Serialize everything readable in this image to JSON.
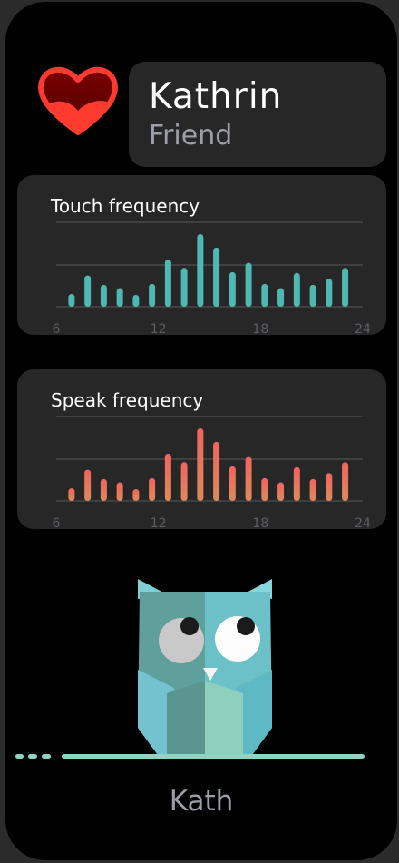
{
  "profile": {
    "name": "Kathrin",
    "relation": "Friend",
    "nickname": "Kath"
  },
  "colors": {
    "heart_fill": "#6e0000",
    "heart_stroke": "#ff3b30",
    "touch_bars": "#4fb7b4",
    "speak_bars_top": "#f0645e",
    "speak_bars_bottom": "#dd8a5a",
    "owl_body": "#5aa6a4",
    "baseline": "#8fd3c3"
  },
  "chart_data": [
    {
      "type": "bar",
      "title": "Touch frequency",
      "x": [
        7,
        8,
        9,
        10,
        11,
        12,
        13,
        14,
        15,
        16,
        17,
        18,
        19,
        20,
        21,
        22,
        23
      ],
      "values": [
        15,
        37,
        26,
        22,
        14,
        27,
        56,
        46,
        86,
        70,
        41,
        52,
        27,
        22,
        40,
        26,
        33,
        46
      ],
      "xlim": [
        6,
        24
      ],
      "xticks": [
        "6",
        "12",
        "18",
        "24"
      ],
      "ylim": [
        0,
        100
      ],
      "grid": true
    },
    {
      "type": "bar",
      "title": "Speak frequency",
      "x": [
        7,
        8,
        9,
        10,
        11,
        12,
        13,
        14,
        15,
        16,
        17,
        18,
        19,
        20,
        21,
        22,
        23
      ],
      "values": [
        15,
        37,
        26,
        22,
        14,
        27,
        56,
        46,
        86,
        70,
        41,
        52,
        27,
        22,
        40,
        26,
        33,
        46
      ],
      "xlim": [
        6,
        24
      ],
      "xticks": [
        "6",
        "12",
        "18",
        "24"
      ],
      "ylim": [
        0,
        100
      ],
      "grid": true
    }
  ]
}
